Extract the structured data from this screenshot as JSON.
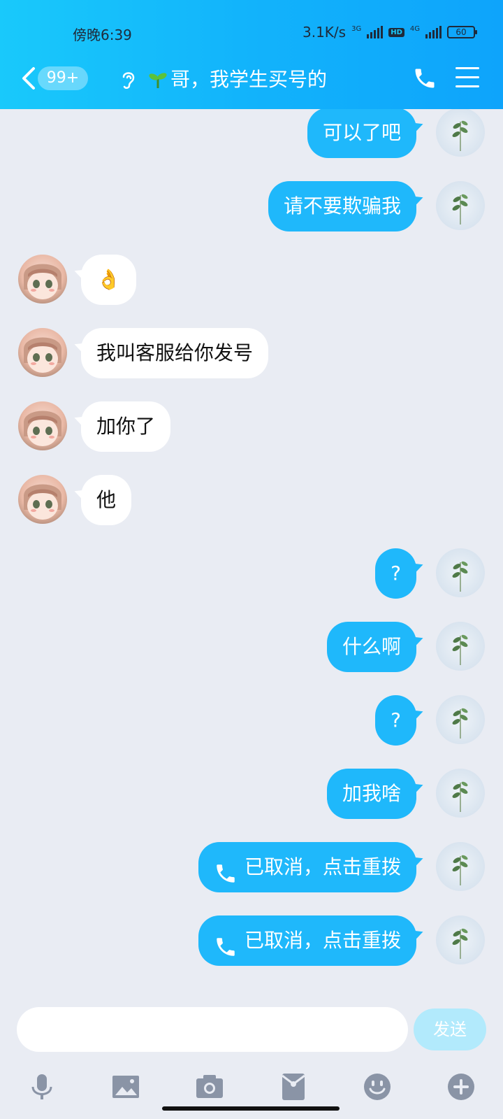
{
  "status_bar": {
    "time": "傍晚6:39",
    "speed": "3.1K/s",
    "net1": "3G",
    "hd": "HD",
    "net2": "4G",
    "battery": "60"
  },
  "header": {
    "unread_badge": "99+",
    "contact_name": "哥，我学生买号的",
    "colors": {
      "gradient_start": "#19c9fb",
      "gradient_end": "#0ea4fb"
    }
  },
  "messages": [
    {
      "side": "out",
      "text": "可以了吧",
      "call": false
    },
    {
      "side": "out",
      "text": "请不要欺骗我",
      "call": false
    },
    {
      "side": "in",
      "text": "👌",
      "call": false
    },
    {
      "side": "in",
      "text": "我叫客服给你发号",
      "call": false
    },
    {
      "side": "in",
      "text": "加你了",
      "call": false
    },
    {
      "side": "in",
      "text": "他",
      "call": false
    },
    {
      "side": "out",
      "text": "?",
      "call": false
    },
    {
      "side": "out",
      "text": "什么啊",
      "call": false
    },
    {
      "side": "out",
      "text": "?",
      "call": false
    },
    {
      "side": "out",
      "text": "加我啥",
      "call": false
    },
    {
      "side": "out",
      "text": "已取消，点击重拨",
      "call": true
    },
    {
      "side": "out",
      "text": "已取消，点击重拨",
      "call": true
    }
  ],
  "composer": {
    "input_value": "",
    "send_label": "发送"
  },
  "toolbar": {
    "icons": [
      "microphone-icon",
      "image-icon",
      "camera-icon",
      "red-packet-icon",
      "emoji-icon",
      "plus-icon"
    ]
  },
  "colors": {
    "bubble_out": "#1fb8fb",
    "bubble_in": "#ffffff",
    "background": "#e9ecf3",
    "send_disabled": "#b2eafc"
  }
}
